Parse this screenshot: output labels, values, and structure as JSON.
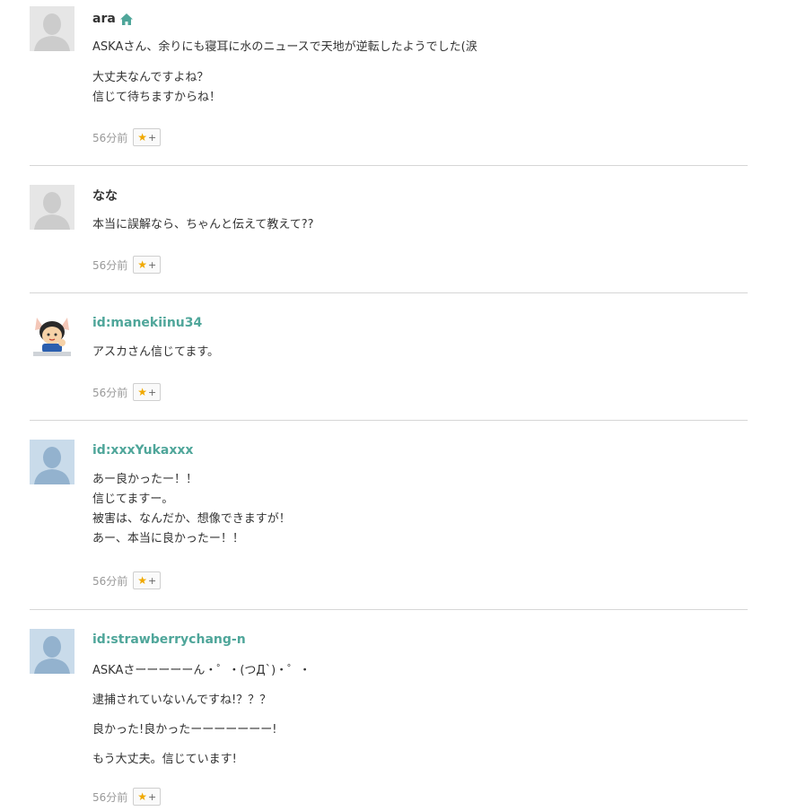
{
  "comments": [
    {
      "name": "ara",
      "is_id": false,
      "has_home_icon": true,
      "avatar": "default-gray",
      "paragraphs": [
        [
          "ASKAさん、余りにも寝耳に水のニュースで天地が逆転したようでした(涙"
        ],
        [
          "大丈夫なんですよね？",
          "信じて待ちますからね！"
        ]
      ],
      "time": "56分前",
      "star_label": "★",
      "plus_label": "+"
    },
    {
      "name": "なな",
      "is_id": false,
      "has_home_icon": false,
      "avatar": "default-gray",
      "paragraphs": [
        [
          "本当に誤解なら、ちゃんと伝えて教えて??"
        ]
      ],
      "time": "56分前",
      "star_label": "★",
      "plus_label": "+"
    },
    {
      "name": "id:manekiinu34",
      "is_id": true,
      "has_home_icon": false,
      "avatar": "character",
      "paragraphs": [
        [
          "アスカさん信じてます。"
        ]
      ],
      "time": "56分前",
      "star_label": "★",
      "plus_label": "+"
    },
    {
      "name": "id:xxxYukaxxx",
      "is_id": true,
      "has_home_icon": false,
      "avatar": "default-blue",
      "paragraphs": [
        [
          "あー良かったー！！",
          "信じてますー。",
          "被害は、なんだか、想像できますが！",
          "あー、本当に良かったー！！"
        ]
      ],
      "time": "56分前",
      "star_label": "★",
      "plus_label": "+"
    },
    {
      "name": "id:strawberrychang-n",
      "is_id": true,
      "has_home_icon": false,
      "avatar": "default-blue",
      "paragraphs": [
        [
          "ASKAさーーーーーん・゜・(つД`)・゜・"
        ],
        [
          "逮捕されていないんですね!？？？"
        ],
        [
          "良かった!良かったーーーーーーー!"
        ],
        [
          "もう大丈夫。信じています!"
        ]
      ],
      "time": "56分前",
      "star_label": "★",
      "plus_label": "+"
    }
  ],
  "icons": {
    "home": "home-icon",
    "star": "star-icon",
    "avatar_default": "user-silhouette-icon",
    "avatar_character": "cat-character-icon"
  },
  "colors": {
    "id_link": "#4fa69a",
    "star": "#f0a800",
    "divider": "#d6d6d6",
    "time": "#999999"
  }
}
